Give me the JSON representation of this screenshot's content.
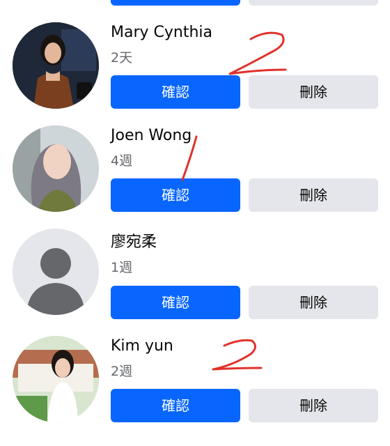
{
  "requests": [
    {
      "name": "Mary Cynthia",
      "time": "2天",
      "confirm_label": "確認",
      "delete_label": "刪除"
    },
    {
      "name": "Joen Wong",
      "time": "4週",
      "confirm_label": "確認",
      "delete_label": "刪除"
    },
    {
      "name": "廖宛柔",
      "time": "1週",
      "confirm_label": "確認",
      "delete_label": "刪除"
    },
    {
      "name": "Kim yun",
      "time": "2週",
      "confirm_label": "確認",
      "delete_label": "刪除"
    }
  ],
  "colors": {
    "confirm": "#0866ff",
    "delete": "#e4e6eb",
    "annotation": "#e0322b"
  }
}
